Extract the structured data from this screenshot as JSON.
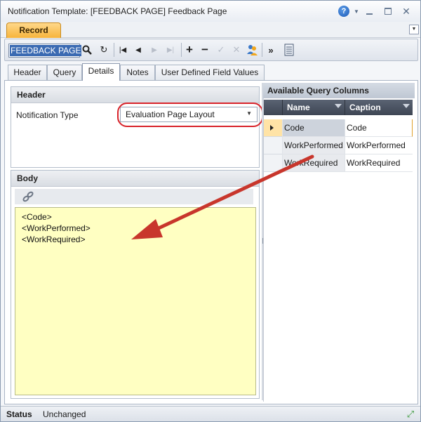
{
  "window": {
    "title": "Notification Template: [FEEDBACK PAGE] Feedback Page"
  },
  "ribbon": {
    "tab_label": "Record"
  },
  "toolbar": {
    "record_field_value": "FEEDBACK PAGE"
  },
  "tabs": [
    {
      "label": "Header"
    },
    {
      "label": "Query"
    },
    {
      "label": "Details"
    },
    {
      "label": "Notes"
    },
    {
      "label": "User Defined Field Values"
    }
  ],
  "active_tab": "Details",
  "header_section": {
    "title": "Header",
    "notification_type_label": "Notification Type",
    "notification_type_value": "Evaluation Page Layout"
  },
  "body_section": {
    "title": "Body",
    "lines": [
      "<Code>",
      "<WorkPerformed>",
      "<WorkRequired>"
    ]
  },
  "query_columns": {
    "title": "Available Query Columns",
    "headers": {
      "name": "Name",
      "caption": "Caption"
    },
    "rows": [
      {
        "name": "Code",
        "caption": "Code"
      },
      {
        "name": "WorkPerformed",
        "caption": "WorkPerformed"
      },
      {
        "name": "WorkRequired",
        "caption": "WorkRequired"
      }
    ]
  },
  "status": {
    "label": "Status",
    "value": "Unchanged"
  },
  "colors": {
    "editor_background": "#ffffc2",
    "ribbon_tab": "#f6b43c",
    "annotation_red": "#c8362c"
  },
  "icons": [
    "help-icon",
    "search-icon",
    "refresh-icon",
    "first-record-icon",
    "previous-record-icon",
    "next-record-icon",
    "last-record-icon",
    "add-icon",
    "delete-icon",
    "save-check-icon",
    "cancel-icon",
    "users-icon",
    "more-icon",
    "report-icon",
    "link-icon",
    "filter-icon",
    "resize-grip-icon"
  ]
}
